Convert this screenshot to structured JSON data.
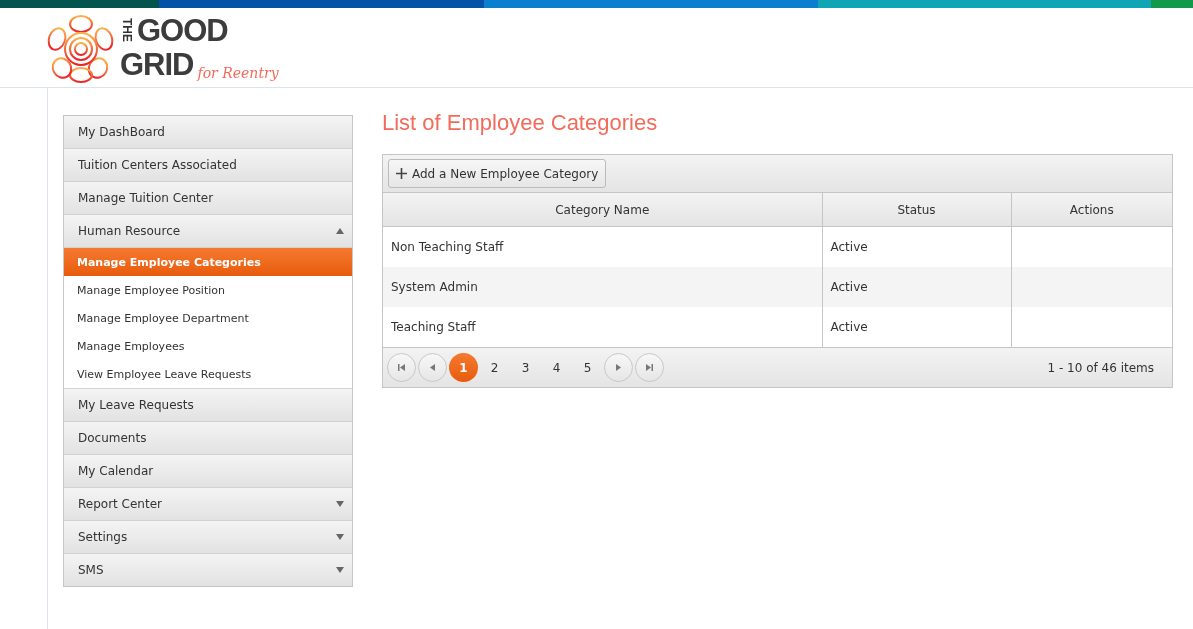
{
  "logo": {
    "the": "THE",
    "good": "GOOD",
    "grid": "GRID",
    "tagline": "for Reentry"
  },
  "sidebar": {
    "items": [
      {
        "label": "My DashBoard",
        "kind": "link"
      },
      {
        "label": "Tuition Centers Associated",
        "kind": "link"
      },
      {
        "label": "Manage Tuition Center",
        "kind": "link"
      },
      {
        "label": "Human Resource",
        "kind": "group",
        "expanded": true,
        "children": [
          {
            "label": "Manage Employee Categories",
            "selected": true
          },
          {
            "label": "Manage Employee Position",
            "selected": false
          },
          {
            "label": "Manage Employee Department",
            "selected": false
          },
          {
            "label": "Manage Employees",
            "selected": false
          },
          {
            "label": "View Employee Leave Requests",
            "selected": false
          }
        ]
      },
      {
        "label": "My Leave Requests",
        "kind": "link"
      },
      {
        "label": "Documents",
        "kind": "link"
      },
      {
        "label": "My Calendar",
        "kind": "link"
      },
      {
        "label": "Report Center",
        "kind": "group",
        "expanded": false
      },
      {
        "label": "Settings",
        "kind": "group",
        "expanded": false
      },
      {
        "label": "SMS",
        "kind": "group",
        "expanded": false
      }
    ]
  },
  "page_title": "List of Employee Categories",
  "toolbar": {
    "add_button": "Add a New Employee Category"
  },
  "table": {
    "columns": [
      "Category Name",
      "Status",
      "Actions"
    ],
    "rows": [
      {
        "category_name": "Non Teaching Staff",
        "status": "Active"
      },
      {
        "category_name": "System Admin",
        "status": "Active"
      },
      {
        "category_name": "Teaching Staff",
        "status": "Active"
      }
    ]
  },
  "pager": {
    "pages": [
      {
        "label": "1",
        "selected": true
      },
      {
        "label": "2",
        "selected": false
      },
      {
        "label": "3",
        "selected": false
      },
      {
        "label": "4",
        "selected": false
      },
      {
        "label": "5",
        "selected": false
      }
    ],
    "info": "1 - 10 of 46 items"
  }
}
